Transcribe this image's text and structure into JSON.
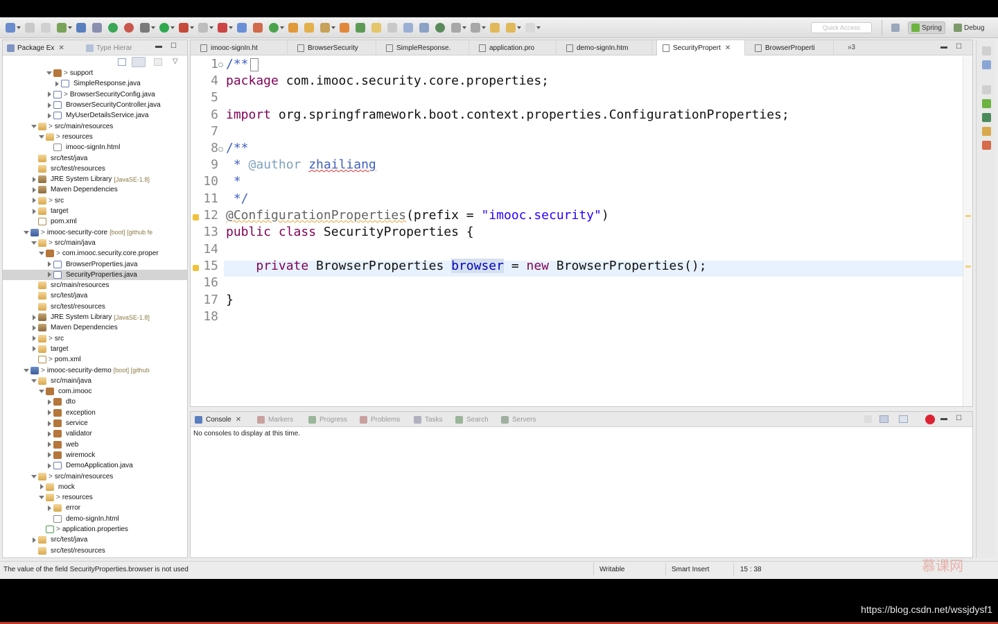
{
  "toolbar": {
    "quick_access_placeholder": "Quick Access",
    "perspectives": [
      {
        "label": "Spring",
        "active": true
      },
      {
        "label": "Debug",
        "active": false
      }
    ]
  },
  "explorer": {
    "tabs": [
      {
        "label": "Package Ex",
        "active": true
      },
      {
        "label": "Type Hierar",
        "active": false
      }
    ],
    "tree": [
      {
        "indent": 5,
        "exp": "down",
        "icon": "ic-pkg",
        "pre": "> ",
        "label": "support",
        "dec": ""
      },
      {
        "indent": 6,
        "exp": "right",
        "icon": "ic-java",
        "pre": "",
        "label": "SimpleResponse.java",
        "dec": ""
      },
      {
        "indent": 5,
        "exp": "right",
        "icon": "ic-java",
        "pre": "> ",
        "label": "BrowserSecurityConfig.java",
        "dec": ""
      },
      {
        "indent": 5,
        "exp": "right",
        "icon": "ic-java",
        "pre": "",
        "label": "BrowserSecurityController.java",
        "dec": ""
      },
      {
        "indent": 5,
        "exp": "right",
        "icon": "ic-java",
        "pre": "",
        "label": "MyUserDetailsService.java",
        "dec": ""
      },
      {
        "indent": 3,
        "exp": "down",
        "icon": "ic-folder",
        "pre": "> ",
        "label": "src/main/resources",
        "dec": ""
      },
      {
        "indent": 4,
        "exp": "down",
        "icon": "ic-folder",
        "pre": "> ",
        "label": "resources",
        "dec": ""
      },
      {
        "indent": 5,
        "exp": "",
        "icon": "ic-html",
        "pre": "",
        "label": "imooc-signIn.html",
        "dec": ""
      },
      {
        "indent": 3,
        "exp": "",
        "icon": "ic-folder",
        "pre": "",
        "label": "src/test/java",
        "dec": ""
      },
      {
        "indent": 3,
        "exp": "",
        "icon": "ic-folder",
        "pre": "",
        "label": "src/test/resources",
        "dec": ""
      },
      {
        "indent": 3,
        "exp": "right",
        "icon": "ic-lib",
        "pre": "",
        "label": "JRE System Library",
        "dec": "[JavaSE-1.8]"
      },
      {
        "indent": 3,
        "exp": "right",
        "icon": "ic-lib",
        "pre": "",
        "label": "Maven Dependencies",
        "dec": ""
      },
      {
        "indent": 3,
        "exp": "right",
        "icon": "ic-folder",
        "pre": "> ",
        "label": "src",
        "dec": ""
      },
      {
        "indent": 3,
        "exp": "right",
        "icon": "ic-folder",
        "pre": "",
        "label": "target",
        "dec": ""
      },
      {
        "indent": 3,
        "exp": "",
        "icon": "ic-xml",
        "pre": "",
        "label": "pom.xml",
        "dec": ""
      },
      {
        "indent": 2,
        "exp": "down",
        "icon": "ic-proj",
        "pre": "> ",
        "label": "imooc-security-core",
        "dec": "[boot] [github fe"
      },
      {
        "indent": 3,
        "exp": "down",
        "icon": "ic-folder",
        "pre": "> ",
        "label": "src/main/java",
        "dec": ""
      },
      {
        "indent": 4,
        "exp": "down",
        "icon": "ic-pkg",
        "pre": "> ",
        "label": "com.imooc.security.core.proper",
        "dec": ""
      },
      {
        "indent": 5,
        "exp": "right",
        "icon": "ic-java",
        "pre": "",
        "label": "BrowserProperties.java",
        "dec": ""
      },
      {
        "indent": 5,
        "exp": "right",
        "icon": "ic-java",
        "pre": "",
        "label": "SecurityProperties.java",
        "dec": "",
        "selected": true
      },
      {
        "indent": 3,
        "exp": "",
        "icon": "ic-folder",
        "pre": "",
        "label": "src/main/resources",
        "dec": ""
      },
      {
        "indent": 3,
        "exp": "",
        "icon": "ic-folder",
        "pre": "",
        "label": "src/test/java",
        "dec": ""
      },
      {
        "indent": 3,
        "exp": "",
        "icon": "ic-folder",
        "pre": "",
        "label": "src/test/resources",
        "dec": ""
      },
      {
        "indent": 3,
        "exp": "right",
        "icon": "ic-lib",
        "pre": "",
        "label": "JRE System Library",
        "dec": "[JavaSE-1.8]"
      },
      {
        "indent": 3,
        "exp": "right",
        "icon": "ic-lib",
        "pre": "",
        "label": "Maven Dependencies",
        "dec": ""
      },
      {
        "indent": 3,
        "exp": "right",
        "icon": "ic-folder",
        "pre": "> ",
        "label": "src",
        "dec": ""
      },
      {
        "indent": 3,
        "exp": "right",
        "icon": "ic-folder",
        "pre": "",
        "label": "target",
        "dec": ""
      },
      {
        "indent": 3,
        "exp": "",
        "icon": "ic-xml",
        "pre": "> ",
        "label": "pom.xml",
        "dec": ""
      },
      {
        "indent": 2,
        "exp": "down",
        "icon": "ic-proj",
        "pre": "> ",
        "label": "imooc-security-demo",
        "dec": "[boot] [github"
      },
      {
        "indent": 3,
        "exp": "down",
        "icon": "ic-folder",
        "pre": "",
        "label": "src/main/java",
        "dec": ""
      },
      {
        "indent": 4,
        "exp": "down",
        "icon": "ic-pkg",
        "pre": "",
        "label": "com.imooc",
        "dec": ""
      },
      {
        "indent": 5,
        "exp": "right",
        "icon": "ic-pkg",
        "pre": "",
        "label": "dto",
        "dec": ""
      },
      {
        "indent": 5,
        "exp": "right",
        "icon": "ic-pkg",
        "pre": "",
        "label": "exception",
        "dec": ""
      },
      {
        "indent": 5,
        "exp": "right",
        "icon": "ic-pkg",
        "pre": "",
        "label": "service",
        "dec": ""
      },
      {
        "indent": 5,
        "exp": "right",
        "icon": "ic-pkg",
        "pre": "",
        "label": "validator",
        "dec": ""
      },
      {
        "indent": 5,
        "exp": "right",
        "icon": "ic-pkg",
        "pre": "",
        "label": "web",
        "dec": ""
      },
      {
        "indent": 5,
        "exp": "right",
        "icon": "ic-pkg",
        "pre": "",
        "label": "wiremock",
        "dec": ""
      },
      {
        "indent": 5,
        "exp": "right",
        "icon": "ic-java",
        "pre": "",
        "label": "DemoApplication.java",
        "dec": ""
      },
      {
        "indent": 3,
        "exp": "down",
        "icon": "ic-folder",
        "pre": "> ",
        "label": "src/main/resources",
        "dec": ""
      },
      {
        "indent": 4,
        "exp": "right",
        "icon": "ic-folder",
        "pre": "",
        "label": "mock",
        "dec": ""
      },
      {
        "indent": 4,
        "exp": "down",
        "icon": "ic-folder",
        "pre": "> ",
        "label": "resources",
        "dec": ""
      },
      {
        "indent": 5,
        "exp": "right",
        "icon": "ic-folder",
        "pre": "",
        "label": "error",
        "dec": ""
      },
      {
        "indent": 5,
        "exp": "",
        "icon": "ic-html",
        "pre": "",
        "label": "demo-signIn.html",
        "dec": ""
      },
      {
        "indent": 4,
        "exp": "",
        "icon": "ic-prop",
        "pre": "> ",
        "label": "application.properties",
        "dec": ""
      },
      {
        "indent": 3,
        "exp": "right",
        "icon": "ic-folder",
        "pre": "",
        "label": "src/test/java",
        "dec": ""
      },
      {
        "indent": 3,
        "exp": "",
        "icon": "ic-folder",
        "pre": "",
        "label": "src/test/resources",
        "dec": ""
      }
    ]
  },
  "editor": {
    "tabs": [
      {
        "label": "imooc-signIn.ht",
        "active": false
      },
      {
        "label": "BrowserSecurity",
        "active": false
      },
      {
        "label": "SimpleResponse.",
        "active": false
      },
      {
        "label": "application.pro",
        "active": false
      },
      {
        "label": "demo-signIn.htm",
        "active": false
      },
      {
        "label": "SecurityPropert",
        "active": true
      },
      {
        "label": "BrowserProperti",
        "active": false
      }
    ],
    "overflow": "»3",
    "line_numbers": [
      "1",
      "4",
      "5",
      "6",
      "7",
      "8",
      "9",
      "10",
      "11",
      "12",
      "13",
      "14",
      "15",
      "16",
      "17",
      "18"
    ],
    "code": {
      "l1": "/**",
      "l4_kw": "package",
      "l4_rest": " com.imooc.security.core.properties;",
      "l6_kw": "import",
      "l6_rest": " org.springframework.boot.context.properties.ConfigurationProperties;",
      "l8": "/**",
      "l9_star": " * ",
      "l9_tag": "@author",
      "l9_name": "zhailiang",
      "l10": " *",
      "l11": " */",
      "l12_an": "@ConfigurationProperties",
      "l12_mid": "(prefix = ",
      "l12_str": "\"imooc.security\"",
      "l12_end": ")",
      "l13_kw1": "public",
      "l13_kw2": "class",
      "l13_rest": " SecurityProperties {",
      "l15_kw": "private",
      "l15_type": " BrowserProperties ",
      "l15_field": "browser",
      "l15_eq": " = ",
      "l15_new": "new",
      "l15_end": " BrowserProperties();",
      "l17": "}"
    }
  },
  "console": {
    "tabs": [
      {
        "label": "Console",
        "active": true
      },
      {
        "label": "Markers",
        "active": false
      },
      {
        "label": "Progress",
        "active": false
      },
      {
        "label": "Problems",
        "active": false
      },
      {
        "label": "Tasks",
        "active": false
      },
      {
        "label": "Search",
        "active": false
      },
      {
        "label": "Servers",
        "active": false
      }
    ],
    "message": "No consoles to display at this time."
  },
  "status": {
    "message": "The value of the field SecurityProperties.browser is not used",
    "writable": "Writable",
    "insert_mode": "Smart Insert",
    "position": "15 : 38"
  },
  "watermark": "慕课网",
  "url_overlay": "https://blog.csdn.net/wssjdysf1"
}
